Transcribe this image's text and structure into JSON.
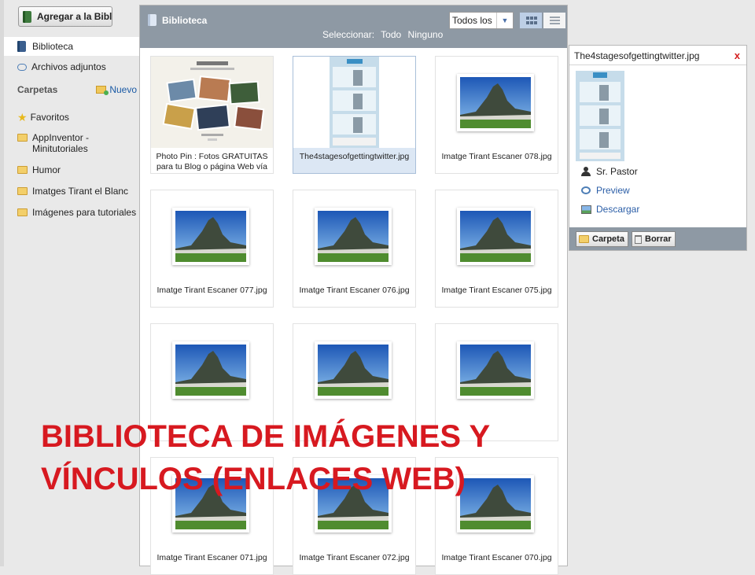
{
  "sidebar": {
    "add_button": "Agregar a la Bibl",
    "nav": [
      {
        "label": "Biblioteca",
        "active": true
      },
      {
        "label": "Archivos adjuntos",
        "active": false
      }
    ],
    "folders_heading": "Carpetas",
    "new_label": "Nuevo",
    "folders": [
      {
        "label": "Favoritos",
        "icon": "star-icon"
      },
      {
        "label": "AppInventor - Minitutoriales",
        "icon": "folder-icon"
      },
      {
        "label": "Humor",
        "icon": "folder-icon"
      },
      {
        "label": "Imatges Tirant el Blanc",
        "icon": "folder-icon"
      },
      {
        "label": "Imágenes para tutoriales",
        "icon": "folder-icon"
      }
    ]
  },
  "main": {
    "title": "Biblioteca",
    "filter_value": "Todos los",
    "view_modes": [
      "grid-view-icon",
      "list-view-icon"
    ],
    "select_label": "Seleccionar:",
    "select_all": "Todo",
    "select_none": "Ninguno",
    "items": [
      {
        "caption": "Photo Pin : Fotos GRATUITAS para tu Blog o página Web vía",
        "kind": "photopin",
        "selected": false
      },
      {
        "caption": "The4stagesofgettingtwitter.jpg",
        "kind": "infographic",
        "selected": true
      },
      {
        "caption": "Imatge Tirant Escaner 078.jpg",
        "kind": "mountain",
        "selected": false
      },
      {
        "caption": "Imatge Tirant Escaner 077.jpg",
        "kind": "mountain",
        "selected": false
      },
      {
        "caption": "Imatge Tirant Escaner 076.jpg",
        "kind": "mountain",
        "selected": false
      },
      {
        "caption": "Imatge Tirant Escaner 075.jpg",
        "kind": "mountain",
        "selected": false
      },
      {
        "caption": "",
        "kind": "mountain",
        "selected": false
      },
      {
        "caption": "",
        "kind": "mountain",
        "selected": false
      },
      {
        "caption": "",
        "kind": "mountain",
        "selected": false
      },
      {
        "caption": "Imatge Tirant Escaner 071.jpg",
        "kind": "mountain",
        "selected": false
      },
      {
        "caption": "Imatge Tirant Escaner 072.jpg",
        "kind": "mountain",
        "selected": false
      },
      {
        "caption": "Imatge Tirant Escaner 070.jpg",
        "kind": "mountain",
        "selected": false
      }
    ]
  },
  "preview": {
    "filename": "The4stagesofgettingtwitter.jpg",
    "close_label": "x",
    "author": "Sr. Pastor",
    "preview_label": "Preview",
    "download_label": "Descargar",
    "folder_button": "Carpeta",
    "delete_button": "Borrar"
  },
  "overlay": {
    "line1": "BIBLIOTECA DE IMÁGENES Y",
    "line2": "VÍNCULOS (ENLACES WEB)"
  },
  "colors": {
    "header_bar": "#8e99a4",
    "overlay_text": "#d71920",
    "link": "#2b5ea7",
    "selected_item": "#dce7f4"
  }
}
